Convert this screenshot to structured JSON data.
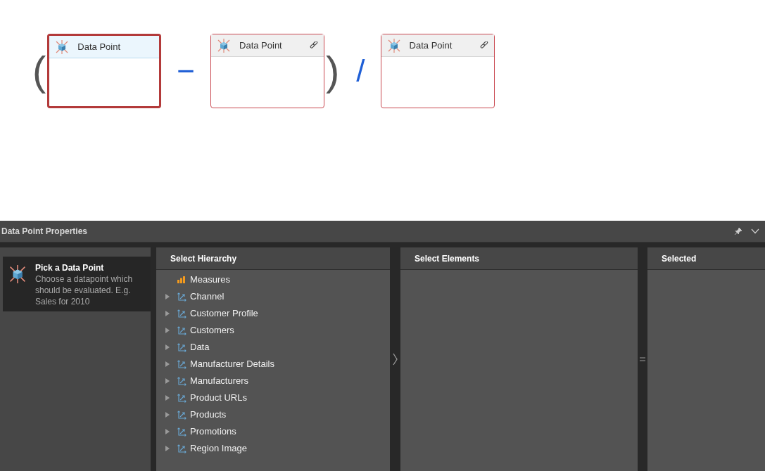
{
  "formula": [
    {
      "kind": "paren",
      "text": "("
    },
    {
      "kind": "card",
      "title": "Data Point",
      "selected": true,
      "linked": false
    },
    {
      "kind": "operator",
      "text": "−"
    },
    {
      "kind": "card",
      "title": "Data Point",
      "selected": false,
      "linked": true
    },
    {
      "kind": "paren",
      "text": ")"
    },
    {
      "kind": "operator",
      "text": "/"
    },
    {
      "kind": "card",
      "title": "Data Point",
      "selected": false,
      "linked": true
    }
  ],
  "panel": {
    "title": "Data Point Properties",
    "steps": [
      {
        "title": "Pick a Data Point",
        "description": "Choose a datapoint which should be evaluated. E.g. Sales for 2010",
        "selected": true
      }
    ],
    "hierarchy": {
      "heading": "Select Hierarchy",
      "items": [
        {
          "kind": "measure",
          "label": "Measures"
        },
        {
          "kind": "hierarchy",
          "label": "Channel",
          "expanded": false
        },
        {
          "kind": "hierarchy",
          "label": "Customer Profile",
          "expanded": false
        },
        {
          "kind": "hierarchy",
          "label": "Customers",
          "expanded": false
        },
        {
          "kind": "hierarchy",
          "label": "Data",
          "expanded": false
        },
        {
          "kind": "hierarchy",
          "label": "Manufacturer Details",
          "expanded": false
        },
        {
          "kind": "hierarchy",
          "label": "Manufacturers",
          "expanded": false
        },
        {
          "kind": "hierarchy",
          "label": "Product URLs",
          "expanded": false
        },
        {
          "kind": "hierarchy",
          "label": "Products",
          "expanded": false
        },
        {
          "kind": "hierarchy",
          "label": "Promotions",
          "expanded": false
        },
        {
          "kind": "hierarchy",
          "label": "Region Image",
          "expanded": false
        }
      ]
    },
    "elements": {
      "heading": "Select Elements"
    },
    "selected": {
      "heading": "Selected"
    }
  }
}
